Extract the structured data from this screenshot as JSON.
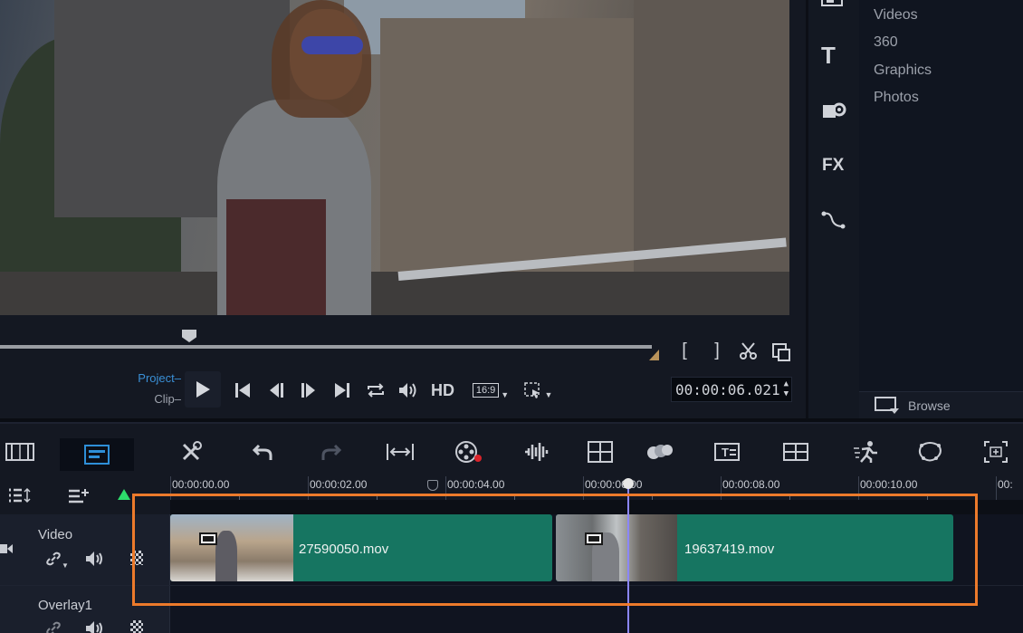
{
  "preview": {
    "project_label": "Project",
    "clip_label": "Clip",
    "hd_label": "HD",
    "aspect_label": "16:9",
    "timecode": "00:00:06.021"
  },
  "library": {
    "categories": [
      "Videos",
      "360",
      "Graphics",
      "Photos"
    ],
    "browse_label": "Browse",
    "strip_icons": [
      "media-icon",
      "title-icon",
      "transition-icon",
      "fx-icon",
      "motion-path-icon"
    ],
    "fx_label": "FX"
  },
  "timeline": {
    "ruler_labels": [
      "00:00:00.00",
      "00:00:02.00",
      "00:00:04.00",
      "00:00:06.00",
      "00:00:08.00",
      "00:00:10.00",
      "00:"
    ],
    "tracks": [
      {
        "name": "Video"
      },
      {
        "name": "Overlay1"
      }
    ],
    "clips": [
      {
        "name": "27590050.mov"
      },
      {
        "name": "19637419.mov"
      }
    ]
  },
  "colors": {
    "clip": "#167561",
    "highlight": "#ec7a2b",
    "playhead": "#8b86ff",
    "project_label": "#3a8fd6"
  }
}
